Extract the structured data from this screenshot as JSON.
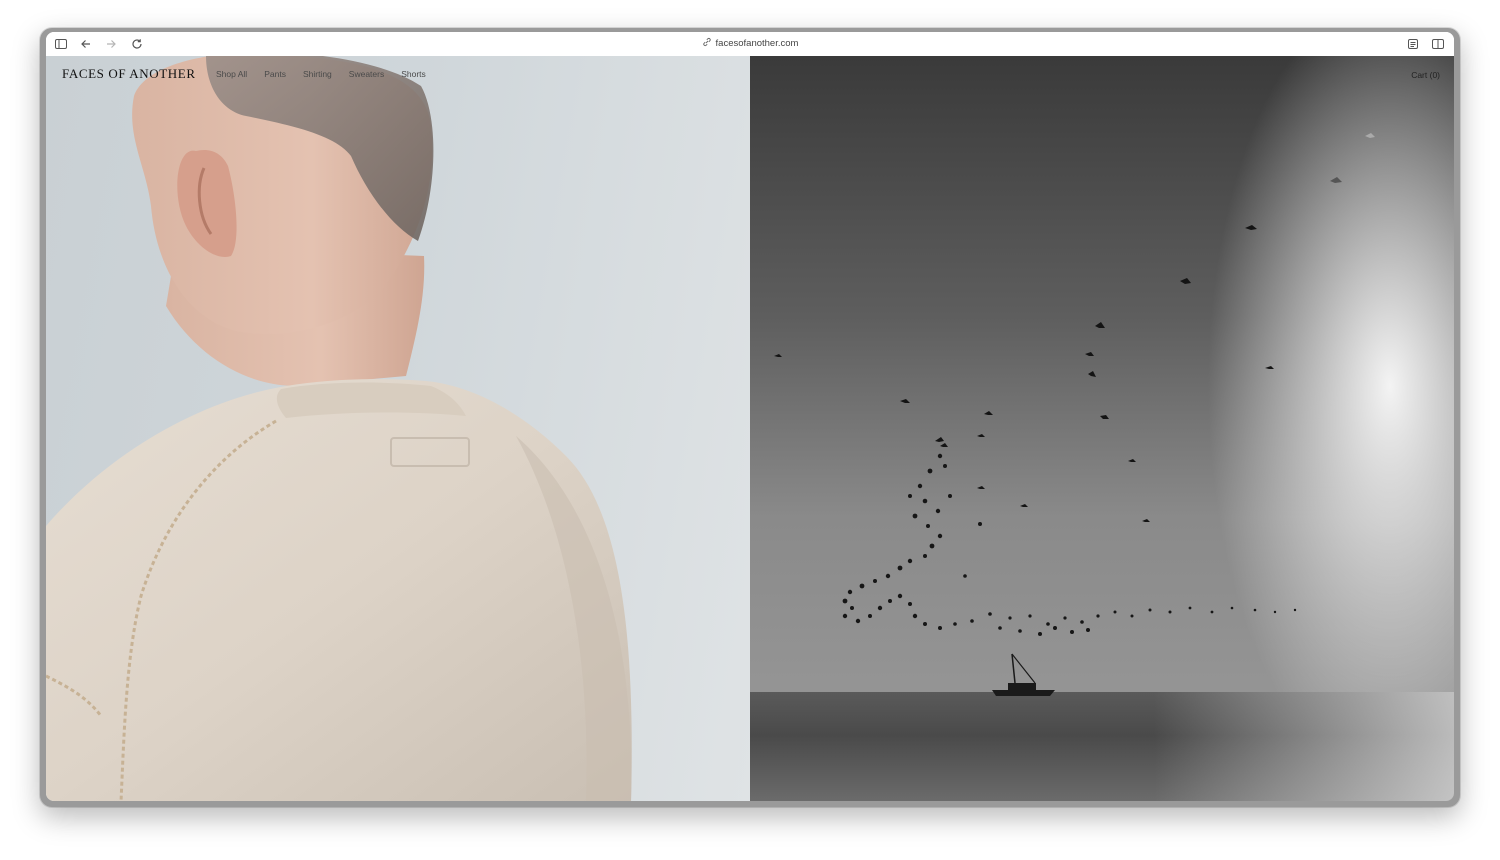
{
  "browser": {
    "url": "facesofanother.com",
    "icons": [
      "sidebar-icon",
      "back-icon",
      "forward-icon",
      "reload-icon",
      "link-icon",
      "reader-icon",
      "split-view-icon"
    ]
  },
  "site": {
    "logo": "FACES OF ANOTHER",
    "nav": [
      "Shop All",
      "Pants",
      "Shirting",
      "Sweaters",
      "Shorts"
    ],
    "cart": "Cart (0)"
  },
  "images": {
    "left": "model-back-photo",
    "right": "birds-over-sea-photo"
  },
  "colors": {
    "accent": "#111111",
    "nav_text": "#4a4a4a"
  }
}
